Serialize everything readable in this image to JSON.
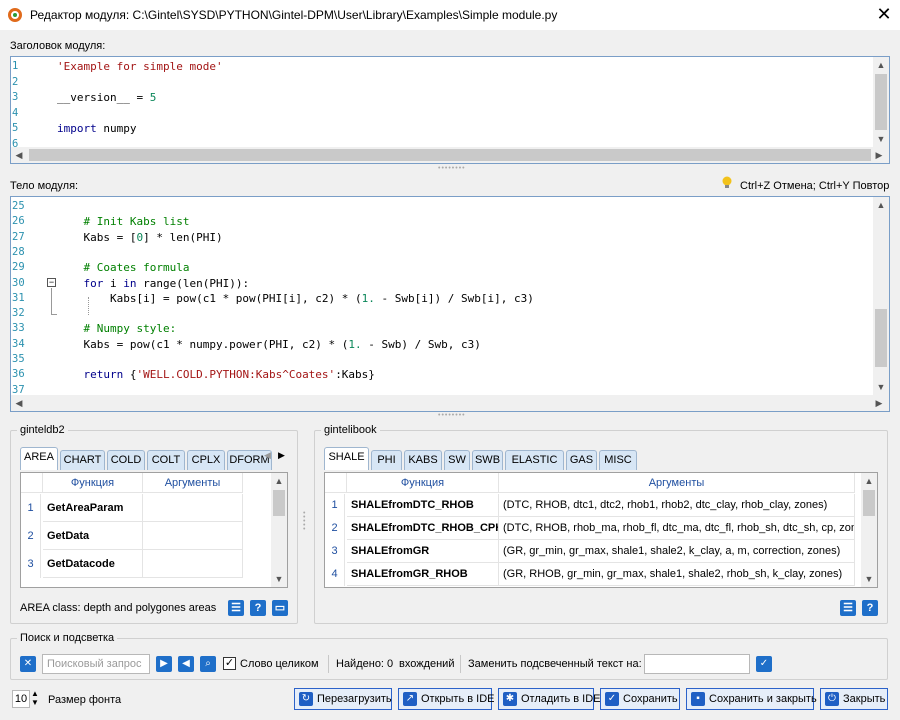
{
  "window": {
    "title": "Редактор модуля: C:\\Gintel\\SYSD\\PYTHON\\Gintel-DPM\\User\\Library\\Examples\\Simple module.py",
    "close": "✕"
  },
  "header_editor": {
    "label": "Заголовок модуля:",
    "lines": [
      {
        "n": "1",
        "code": [
          {
            "t": "'Example for simple mode'",
            "c": "str"
          }
        ]
      },
      {
        "n": "2",
        "code": []
      },
      {
        "n": "3",
        "code": [
          {
            "t": "__version__ = ",
            "c": ""
          },
          {
            "t": "5",
            "c": "num"
          }
        ]
      },
      {
        "n": "4",
        "code": []
      },
      {
        "n": "5",
        "code": [
          {
            "t": "import",
            "c": "kw"
          },
          {
            "t": " numpy",
            "c": ""
          }
        ]
      },
      {
        "n": "6",
        "code": []
      }
    ]
  },
  "body_editor": {
    "label": "Тело модуля:",
    "hint": "Ctrl+Z Отмена; Ctrl+Y Повтор",
    "lines": [
      {
        "n": "25",
        "code": []
      },
      {
        "n": "26",
        "code": [
          {
            "t": "    # Init Kabs list",
            "c": "cm"
          }
        ]
      },
      {
        "n": "27",
        "code": [
          {
            "t": "    Kabs = [",
            "c": ""
          },
          {
            "t": "0",
            "c": "num"
          },
          {
            "t": "] * len(PHI)",
            "c": ""
          }
        ]
      },
      {
        "n": "28",
        "code": []
      },
      {
        "n": "29",
        "code": [
          {
            "t": "    # Coates formula",
            "c": "cm"
          }
        ]
      },
      {
        "n": "30",
        "code": [
          {
            "t": "    ",
            "c": ""
          },
          {
            "t": "for",
            "c": "kw"
          },
          {
            "t": " i ",
            "c": ""
          },
          {
            "t": "in",
            "c": "kw"
          },
          {
            "t": " range(len(PHI)):",
            "c": ""
          }
        ]
      },
      {
        "n": "31",
        "code": [
          {
            "t": "        Kabs[i] = pow(c1 * pow(PHI[i], c2) * (",
            "c": ""
          },
          {
            "t": "1.",
            "c": "num"
          },
          {
            "t": " - Swb[i]) / Swb[i], c3)",
            "c": ""
          }
        ]
      },
      {
        "n": "32",
        "code": []
      },
      {
        "n": "33",
        "code": [
          {
            "t": "    # Numpy style:",
            "c": "cm"
          }
        ]
      },
      {
        "n": "34",
        "code": [
          {
            "t": "    Kabs = pow(c1 * numpy.power(PHI, c2) * (",
            "c": ""
          },
          {
            "t": "1.",
            "c": "num"
          },
          {
            "t": " - Swb) / Swb, c3)",
            "c": ""
          }
        ]
      },
      {
        "n": "35",
        "code": []
      },
      {
        "n": "36",
        "code": [
          {
            "t": "    ",
            "c": ""
          },
          {
            "t": "return",
            "c": "kw"
          },
          {
            "t": " {",
            "c": ""
          },
          {
            "t": "'WELL.COLD.PYTHON:Kabs^Coates'",
            "c": "str"
          },
          {
            "t": ":Kabs}",
            "c": ""
          }
        ]
      },
      {
        "n": "37",
        "code": []
      }
    ]
  },
  "left_panel": {
    "title": "ginteldb2",
    "tabs": [
      "AREA",
      "CHART",
      "COLD",
      "COLT",
      "CPLX",
      "DFORM"
    ],
    "col_function": "Функция",
    "col_args": "Аргументы",
    "rows": [
      {
        "n": "1",
        "func": "GetAreaParam",
        "args": ""
      },
      {
        "n": "2",
        "func": "GetData",
        "args": ""
      },
      {
        "n": "3",
        "func": "GetDatacode",
        "args": ""
      }
    ],
    "status": "AREA class: depth and polygones areas"
  },
  "right_panel": {
    "title": "gintelibook",
    "tabs": [
      "SHALE",
      "PHI",
      "KABS",
      "SW",
      "SWB",
      "ELASTIC",
      "GAS",
      "MISC"
    ],
    "col_function": "Функция",
    "col_args": "Аргументы",
    "rows": [
      {
        "n": "1",
        "func": "SHALEfromDTC_RHOB",
        "args": "(DTC, RHOB, dtc1, dtc2, rhob1, rhob2, dtc_clay, rhob_clay, zones)"
      },
      {
        "n": "2",
        "func": "SHALEfromDTC_RHOB_CPH",
        "args": "(DTC, RHOB, rhob_ma, rhob_fl, dtc_ma, dtc_fl, rhob_sh, dtc_sh, cp, zones)"
      },
      {
        "n": "3",
        "func": "SHALEfromGR",
        "args": "(GR, gr_min, gr_max, shale1, shale2, k_clay, a, m, correction, zones)"
      },
      {
        "n": "4",
        "func": "SHALEfromGR_RHOB",
        "args": "(GR, RHOB, gr_min, gr_max, shale1, shale2, rhob_sh, k_clay, zones)"
      }
    ]
  },
  "search": {
    "title": "Поиск и подсветка",
    "placeholder": "Поисковый запрос",
    "whole_word": "Слово целиком",
    "found": "Найдено:",
    "found_count": "0",
    "found_unit": "вхождений",
    "replace_label": "Заменить подсвеченный текст на:",
    "replace_value": ""
  },
  "footer": {
    "font_size": "10",
    "font_size_label": "Размер фонта",
    "buttons": {
      "reload": "Перезагрузить",
      "open_ide": "Открыть в IDE",
      "debug_ide": "Отладить в IDE",
      "save": "Сохранить",
      "save_close": "Сохранить и закрыть",
      "close": "Закрыть"
    }
  },
  "colors": {
    "accent": "#1f6fc9",
    "keyword": "#00008b",
    "string": "#a31515",
    "comment": "#008000",
    "line_number": "#2b91af"
  }
}
